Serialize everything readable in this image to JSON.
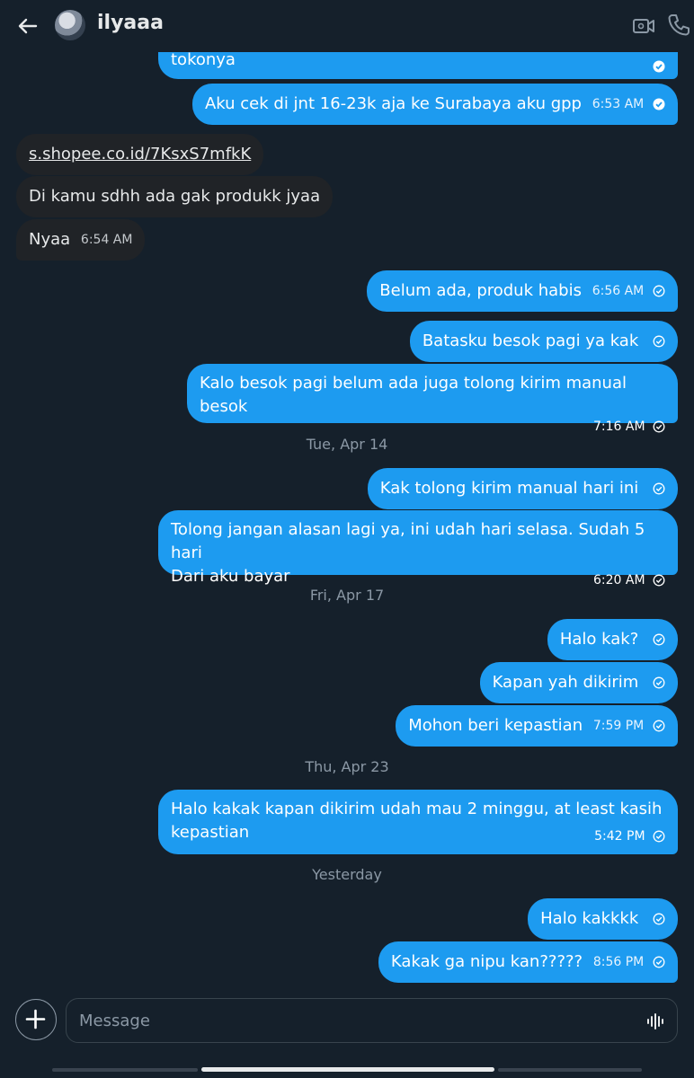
{
  "header": {
    "title": "ilyaaa"
  },
  "messages": {
    "m0": {
      "text": "tokonya"
    },
    "m1": {
      "text": "Aku cek di jnt 16-23k aja ke Surabaya aku gpp",
      "time": "6:53 AM"
    },
    "m2": {
      "text": "s.shopee.co.id/7KsxS7mfkK"
    },
    "m3": {
      "text": "Di kamu sdhh ada gak produkk jyaa"
    },
    "m4": {
      "text": "Nyaa",
      "time": "6:54 AM"
    },
    "m5": {
      "text": "Belum ada, produk habis",
      "time": "6:56 AM"
    },
    "m6": {
      "text": "Batasku besok pagi ya kak"
    },
    "m7": {
      "text": "Kalo besok pagi belum ada juga tolong kirim manual besok",
      "time": "7:16 AM"
    },
    "m8": {
      "text": "Kak tolong kirim manual hari ini"
    },
    "m9": {
      "line1": "Tolong jangan alasan lagi ya, ini udah hari selasa. Sudah 5 hari",
      "line2": "Dari aku bayar",
      "time": "6:20 AM"
    },
    "m10": {
      "text": "Halo kak?"
    },
    "m11": {
      "text": "Kapan yah dikirim"
    },
    "m12": {
      "text": "Mohon beri kepastian",
      "time": "7:59 PM"
    },
    "m13": {
      "line1": "Halo kakak kapan dikirim udah mau 2 minggu, at least kasih",
      "line2": "kepastian",
      "time": "5:42 PM"
    },
    "m14": {
      "text": "Halo kakkkk"
    },
    "m15": {
      "text": "Kakak ga nipu kan?????",
      "time": "8:56 PM"
    }
  },
  "date_separators": {
    "d1": "Tue, Apr 14",
    "d2": "Fri, Apr 17",
    "d3": "Thu, Apr 23",
    "d4": "Yesterday"
  },
  "composer": {
    "placeholder": "Message"
  },
  "colors": {
    "background": "#15202b",
    "outgoing_bubble": "#1d9bf0",
    "incoming_bubble": "#202327",
    "muted_text": "#8b98a5"
  },
  "icons": {
    "back": "back-arrow-icon",
    "video": "video-camera-icon",
    "call": "phone-icon",
    "add": "plus-icon",
    "voice": "voice-wave-icon",
    "read": "read-check-icon"
  }
}
